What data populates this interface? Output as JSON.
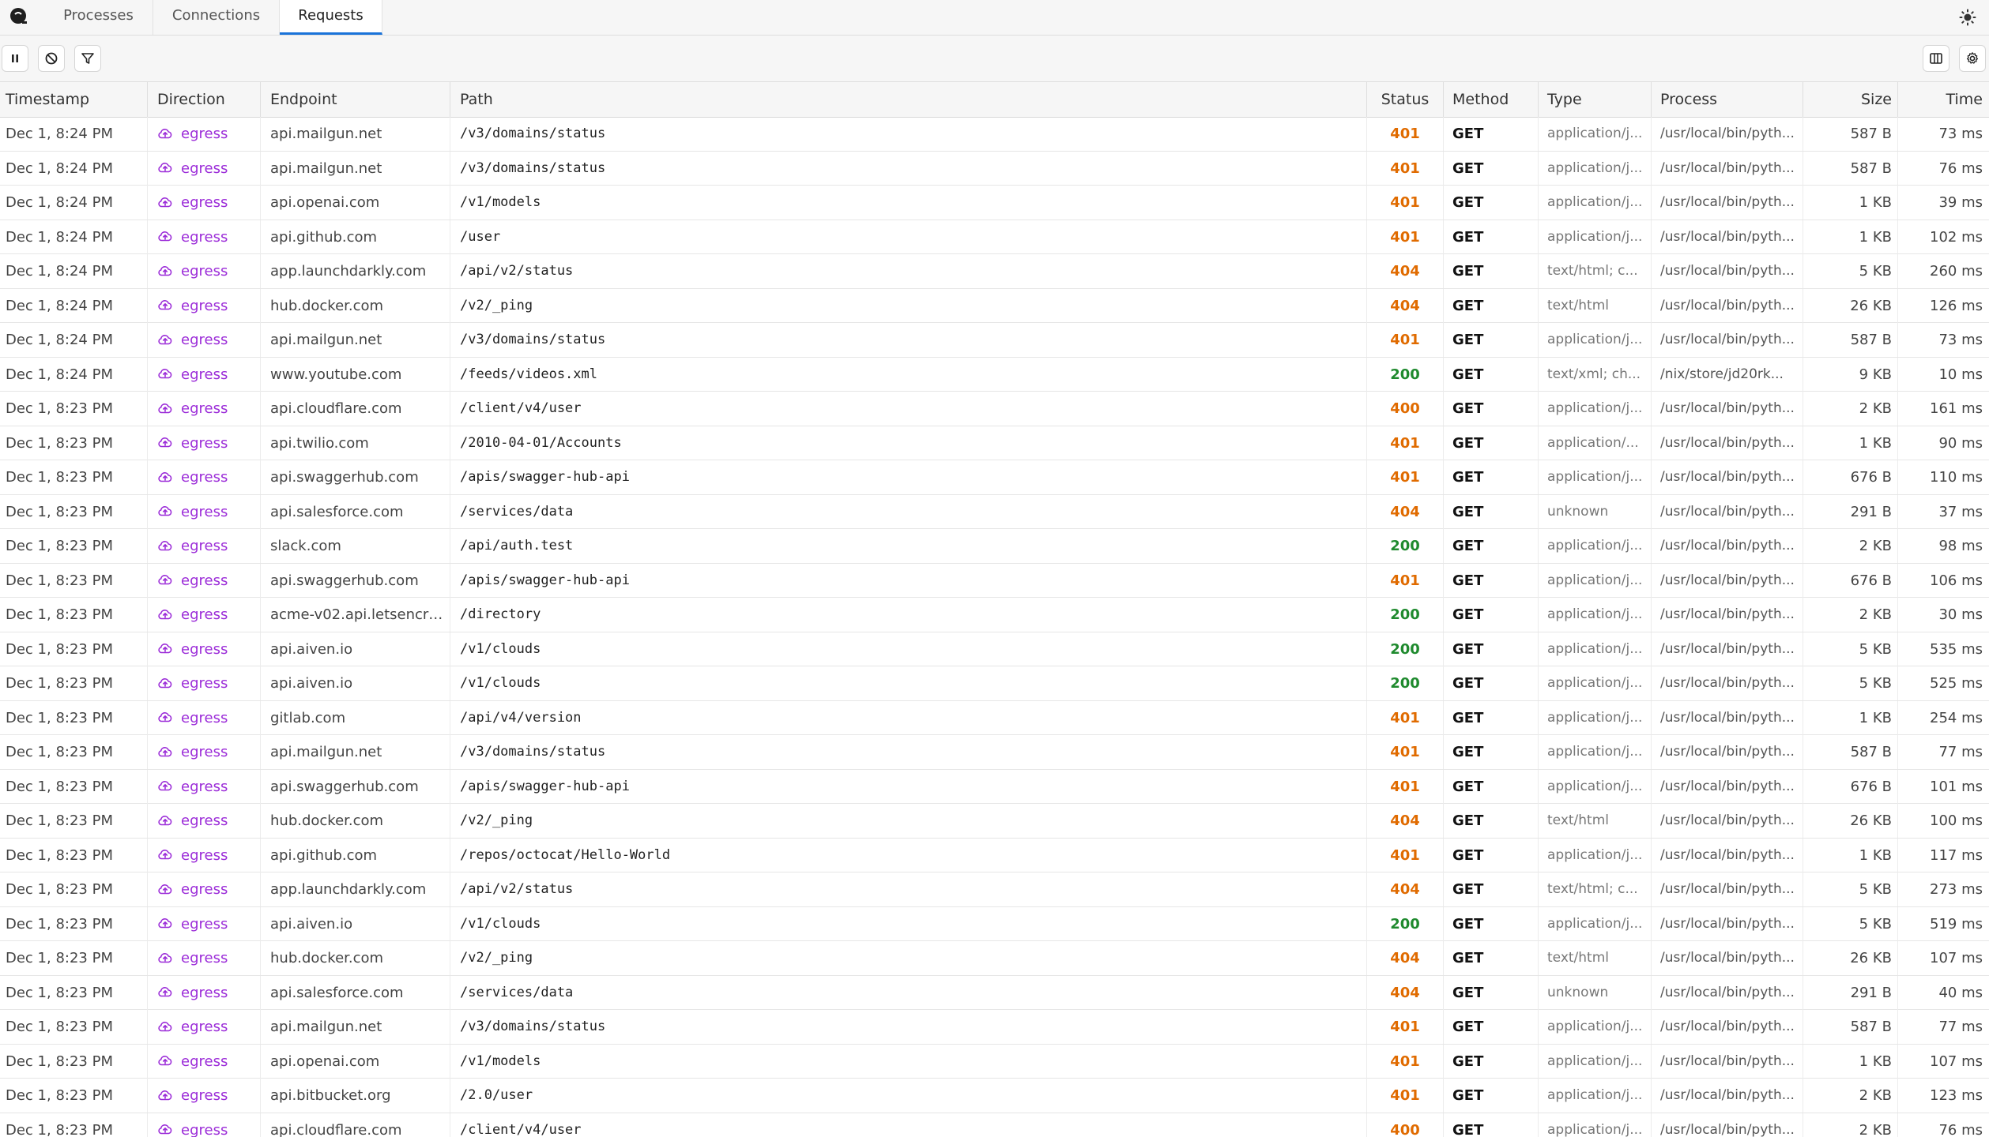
{
  "tabs": [
    {
      "label": "Processes",
      "active": false
    },
    {
      "label": "Connections",
      "active": false
    },
    {
      "label": "Requests",
      "active": true
    }
  ],
  "columns": {
    "timestamp": "Timestamp",
    "direction": "Direction",
    "endpoint": "Endpoint",
    "path": "Path",
    "status": "Status",
    "method": "Method",
    "type": "Type",
    "process": "Process",
    "size": "Size",
    "time": "Time"
  },
  "colors": {
    "accent": "#1a73d9",
    "egress": "#9b2bd8",
    "status_error": "#e06b00",
    "status_ok": "#1f8a2e"
  },
  "toolbar": {
    "icons": [
      "pause-icon",
      "clear-icon",
      "filter-icon"
    ],
    "right_icons": [
      "columns-icon",
      "settings-icon"
    ]
  },
  "rows": [
    {
      "ts": "Dec 1, 8:24 PM",
      "dir": "egress",
      "ep": "api.mailgun.net",
      "path": "/v3/domains/status",
      "status": "401",
      "method": "GET",
      "type": "application/j...",
      "proc": "/usr/local/bin/pyth...",
      "size": "587 B",
      "time": "73 ms"
    },
    {
      "ts": "Dec 1, 8:24 PM",
      "dir": "egress",
      "ep": "api.mailgun.net",
      "path": "/v3/domains/status",
      "status": "401",
      "method": "GET",
      "type": "application/j...",
      "proc": "/usr/local/bin/pyth...",
      "size": "587 B",
      "time": "76 ms"
    },
    {
      "ts": "Dec 1, 8:24 PM",
      "dir": "egress",
      "ep": "api.openai.com",
      "path": "/v1/models",
      "status": "401",
      "method": "GET",
      "type": "application/j...",
      "proc": "/usr/local/bin/pyth...",
      "size": "1 KB",
      "time": "39 ms"
    },
    {
      "ts": "Dec 1, 8:24 PM",
      "dir": "egress",
      "ep": "api.github.com",
      "path": "/user",
      "status": "401",
      "method": "GET",
      "type": "application/j...",
      "proc": "/usr/local/bin/pyth...",
      "size": "1 KB",
      "time": "102 ms"
    },
    {
      "ts": "Dec 1, 8:24 PM",
      "dir": "egress",
      "ep": "app.launchdarkly.com",
      "path": "/api/v2/status",
      "status": "404",
      "method": "GET",
      "type": "text/html; c...",
      "proc": "/usr/local/bin/pyth...",
      "size": "5 KB",
      "time": "260 ms"
    },
    {
      "ts": "Dec 1, 8:24 PM",
      "dir": "egress",
      "ep": "hub.docker.com",
      "path": "/v2/_ping",
      "status": "404",
      "method": "GET",
      "type": "text/html",
      "proc": "/usr/local/bin/pyth...",
      "size": "26 KB",
      "time": "126 ms"
    },
    {
      "ts": "Dec 1, 8:24 PM",
      "dir": "egress",
      "ep": "api.mailgun.net",
      "path": "/v3/domains/status",
      "status": "401",
      "method": "GET",
      "type": "application/j...",
      "proc": "/usr/local/bin/pyth...",
      "size": "587 B",
      "time": "73 ms"
    },
    {
      "ts": "Dec 1, 8:24 PM",
      "dir": "egress",
      "ep": "www.youtube.com",
      "path": "/feeds/videos.xml",
      "status": "200",
      "method": "GET",
      "type": "text/xml; ch...",
      "proc": "/nix/store/jd20rk...",
      "size": "9 KB",
      "time": "10 ms"
    },
    {
      "ts": "Dec 1, 8:23 PM",
      "dir": "egress",
      "ep": "api.cloudflare.com",
      "path": "/client/v4/user",
      "status": "400",
      "method": "GET",
      "type": "application/j...",
      "proc": "/usr/local/bin/pyth...",
      "size": "2 KB",
      "time": "161 ms"
    },
    {
      "ts": "Dec 1, 8:23 PM",
      "dir": "egress",
      "ep": "api.twilio.com",
      "path": "/2010-04-01/Accounts",
      "status": "401",
      "method": "GET",
      "type": "application/...",
      "proc": "/usr/local/bin/pyth...",
      "size": "1 KB",
      "time": "90 ms"
    },
    {
      "ts": "Dec 1, 8:23 PM",
      "dir": "egress",
      "ep": "api.swaggerhub.com",
      "path": "/apis/swagger-hub-api",
      "status": "401",
      "method": "GET",
      "type": "application/j...",
      "proc": "/usr/local/bin/pyth...",
      "size": "676 B",
      "time": "110 ms"
    },
    {
      "ts": "Dec 1, 8:23 PM",
      "dir": "egress",
      "ep": "api.salesforce.com",
      "path": "/services/data",
      "status": "404",
      "method": "GET",
      "type": "unknown",
      "proc": "/usr/local/bin/pyth...",
      "size": "291 B",
      "time": "37 ms"
    },
    {
      "ts": "Dec 1, 8:23 PM",
      "dir": "egress",
      "ep": "slack.com",
      "path": "/api/auth.test",
      "status": "200",
      "method": "GET",
      "type": "application/j...",
      "proc": "/usr/local/bin/pyth...",
      "size": "2 KB",
      "time": "98 ms"
    },
    {
      "ts": "Dec 1, 8:23 PM",
      "dir": "egress",
      "ep": "api.swaggerhub.com",
      "path": "/apis/swagger-hub-api",
      "status": "401",
      "method": "GET",
      "type": "application/j...",
      "proc": "/usr/local/bin/pyth...",
      "size": "676 B",
      "time": "106 ms"
    },
    {
      "ts": "Dec 1, 8:23 PM",
      "dir": "egress",
      "ep": "acme-v02.api.letsencry...",
      "path": "/directory",
      "status": "200",
      "method": "GET",
      "type": "application/j...",
      "proc": "/usr/local/bin/pyth...",
      "size": "2 KB",
      "time": "30 ms"
    },
    {
      "ts": "Dec 1, 8:23 PM",
      "dir": "egress",
      "ep": "api.aiven.io",
      "path": "/v1/clouds",
      "status": "200",
      "method": "GET",
      "type": "application/j...",
      "proc": "/usr/local/bin/pyth...",
      "size": "5 KB",
      "time": "535 ms"
    },
    {
      "ts": "Dec 1, 8:23 PM",
      "dir": "egress",
      "ep": "api.aiven.io",
      "path": "/v1/clouds",
      "status": "200",
      "method": "GET",
      "type": "application/j...",
      "proc": "/usr/local/bin/pyth...",
      "size": "5 KB",
      "time": "525 ms"
    },
    {
      "ts": "Dec 1, 8:23 PM",
      "dir": "egress",
      "ep": "gitlab.com",
      "path": "/api/v4/version",
      "status": "401",
      "method": "GET",
      "type": "application/j...",
      "proc": "/usr/local/bin/pyth...",
      "size": "1 KB",
      "time": "254 ms"
    },
    {
      "ts": "Dec 1, 8:23 PM",
      "dir": "egress",
      "ep": "api.mailgun.net",
      "path": "/v3/domains/status",
      "status": "401",
      "method": "GET",
      "type": "application/j...",
      "proc": "/usr/local/bin/pyth...",
      "size": "587 B",
      "time": "77 ms"
    },
    {
      "ts": "Dec 1, 8:23 PM",
      "dir": "egress",
      "ep": "api.swaggerhub.com",
      "path": "/apis/swagger-hub-api",
      "status": "401",
      "method": "GET",
      "type": "application/j...",
      "proc": "/usr/local/bin/pyth...",
      "size": "676 B",
      "time": "101 ms"
    },
    {
      "ts": "Dec 1, 8:23 PM",
      "dir": "egress",
      "ep": "hub.docker.com",
      "path": "/v2/_ping",
      "status": "404",
      "method": "GET",
      "type": "text/html",
      "proc": "/usr/local/bin/pyth...",
      "size": "26 KB",
      "time": "100 ms"
    },
    {
      "ts": "Dec 1, 8:23 PM",
      "dir": "egress",
      "ep": "api.github.com",
      "path": "/repos/octocat/Hello-World",
      "status": "401",
      "method": "GET",
      "type": "application/j...",
      "proc": "/usr/local/bin/pyth...",
      "size": "1 KB",
      "time": "117 ms"
    },
    {
      "ts": "Dec 1, 8:23 PM",
      "dir": "egress",
      "ep": "app.launchdarkly.com",
      "path": "/api/v2/status",
      "status": "404",
      "method": "GET",
      "type": "text/html; c...",
      "proc": "/usr/local/bin/pyth...",
      "size": "5 KB",
      "time": "273 ms"
    },
    {
      "ts": "Dec 1, 8:23 PM",
      "dir": "egress",
      "ep": "api.aiven.io",
      "path": "/v1/clouds",
      "status": "200",
      "method": "GET",
      "type": "application/j...",
      "proc": "/usr/local/bin/pyth...",
      "size": "5 KB",
      "time": "519 ms"
    },
    {
      "ts": "Dec 1, 8:23 PM",
      "dir": "egress",
      "ep": "hub.docker.com",
      "path": "/v2/_ping",
      "status": "404",
      "method": "GET",
      "type": "text/html",
      "proc": "/usr/local/bin/pyth...",
      "size": "26 KB",
      "time": "107 ms"
    },
    {
      "ts": "Dec 1, 8:23 PM",
      "dir": "egress",
      "ep": "api.salesforce.com",
      "path": "/services/data",
      "status": "404",
      "method": "GET",
      "type": "unknown",
      "proc": "/usr/local/bin/pyth...",
      "size": "291 B",
      "time": "40 ms"
    },
    {
      "ts": "Dec 1, 8:23 PM",
      "dir": "egress",
      "ep": "api.mailgun.net",
      "path": "/v3/domains/status",
      "status": "401",
      "method": "GET",
      "type": "application/j...",
      "proc": "/usr/local/bin/pyth...",
      "size": "587 B",
      "time": "77 ms"
    },
    {
      "ts": "Dec 1, 8:23 PM",
      "dir": "egress",
      "ep": "api.openai.com",
      "path": "/v1/models",
      "status": "401",
      "method": "GET",
      "type": "application/j...",
      "proc": "/usr/local/bin/pyth...",
      "size": "1 KB",
      "time": "107 ms"
    },
    {
      "ts": "Dec 1, 8:23 PM",
      "dir": "egress",
      "ep": "api.bitbucket.org",
      "path": "/2.0/user",
      "status": "401",
      "method": "GET",
      "type": "application/j...",
      "proc": "/usr/local/bin/pyth...",
      "size": "2 KB",
      "time": "123 ms"
    },
    {
      "ts": "Dec 1, 8:23 PM",
      "dir": "egress",
      "ep": "api.cloudflare.com",
      "path": "/client/v4/user",
      "status": "400",
      "method": "GET",
      "type": "application/j...",
      "proc": "/usr/local/bin/pyth...",
      "size": "2 KB",
      "time": "76 ms"
    }
  ]
}
